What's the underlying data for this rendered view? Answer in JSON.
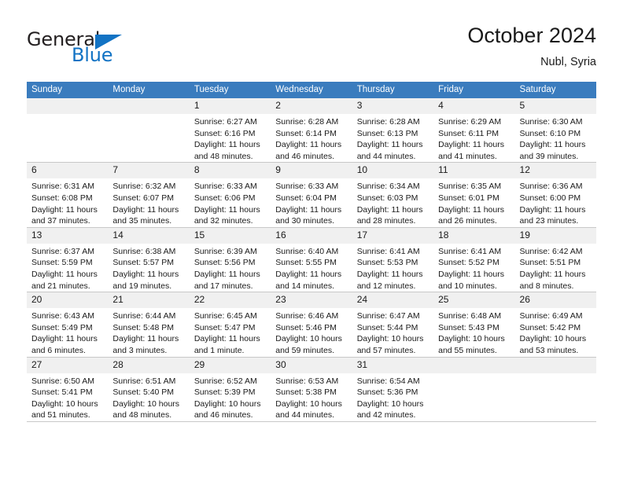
{
  "brand": {
    "name_part1": "General",
    "name_part2": "Blue",
    "accent_color": "#1273c4"
  },
  "header": {
    "title": "October 2024",
    "location": "Nubl, Syria"
  },
  "calendar": {
    "header_color": "#3a7cbe",
    "weekdays": [
      "Sunday",
      "Monday",
      "Tuesday",
      "Wednesday",
      "Thursday",
      "Friday",
      "Saturday"
    ],
    "weeks": [
      [
        {
          "day": ""
        },
        {
          "day": ""
        },
        {
          "day": "1",
          "sunrise": "Sunrise: 6:27 AM",
          "sunset": "Sunset: 6:16 PM",
          "daylight1": "Daylight: 11 hours",
          "daylight2": "and 48 minutes."
        },
        {
          "day": "2",
          "sunrise": "Sunrise: 6:28 AM",
          "sunset": "Sunset: 6:14 PM",
          "daylight1": "Daylight: 11 hours",
          "daylight2": "and 46 minutes."
        },
        {
          "day": "3",
          "sunrise": "Sunrise: 6:28 AM",
          "sunset": "Sunset: 6:13 PM",
          "daylight1": "Daylight: 11 hours",
          "daylight2": "and 44 minutes."
        },
        {
          "day": "4",
          "sunrise": "Sunrise: 6:29 AM",
          "sunset": "Sunset: 6:11 PM",
          "daylight1": "Daylight: 11 hours",
          "daylight2": "and 41 minutes."
        },
        {
          "day": "5",
          "sunrise": "Sunrise: 6:30 AM",
          "sunset": "Sunset: 6:10 PM",
          "daylight1": "Daylight: 11 hours",
          "daylight2": "and 39 minutes."
        }
      ],
      [
        {
          "day": "6",
          "sunrise": "Sunrise: 6:31 AM",
          "sunset": "Sunset: 6:08 PM",
          "daylight1": "Daylight: 11 hours",
          "daylight2": "and 37 minutes."
        },
        {
          "day": "7",
          "sunrise": "Sunrise: 6:32 AM",
          "sunset": "Sunset: 6:07 PM",
          "daylight1": "Daylight: 11 hours",
          "daylight2": "and 35 minutes."
        },
        {
          "day": "8",
          "sunrise": "Sunrise: 6:33 AM",
          "sunset": "Sunset: 6:06 PM",
          "daylight1": "Daylight: 11 hours",
          "daylight2": "and 32 minutes."
        },
        {
          "day": "9",
          "sunrise": "Sunrise: 6:33 AM",
          "sunset": "Sunset: 6:04 PM",
          "daylight1": "Daylight: 11 hours",
          "daylight2": "and 30 minutes."
        },
        {
          "day": "10",
          "sunrise": "Sunrise: 6:34 AM",
          "sunset": "Sunset: 6:03 PM",
          "daylight1": "Daylight: 11 hours",
          "daylight2": "and 28 minutes."
        },
        {
          "day": "11",
          "sunrise": "Sunrise: 6:35 AM",
          "sunset": "Sunset: 6:01 PM",
          "daylight1": "Daylight: 11 hours",
          "daylight2": "and 26 minutes."
        },
        {
          "day": "12",
          "sunrise": "Sunrise: 6:36 AM",
          "sunset": "Sunset: 6:00 PM",
          "daylight1": "Daylight: 11 hours",
          "daylight2": "and 23 minutes."
        }
      ],
      [
        {
          "day": "13",
          "sunrise": "Sunrise: 6:37 AM",
          "sunset": "Sunset: 5:59 PM",
          "daylight1": "Daylight: 11 hours",
          "daylight2": "and 21 minutes."
        },
        {
          "day": "14",
          "sunrise": "Sunrise: 6:38 AM",
          "sunset": "Sunset: 5:57 PM",
          "daylight1": "Daylight: 11 hours",
          "daylight2": "and 19 minutes."
        },
        {
          "day": "15",
          "sunrise": "Sunrise: 6:39 AM",
          "sunset": "Sunset: 5:56 PM",
          "daylight1": "Daylight: 11 hours",
          "daylight2": "and 17 minutes."
        },
        {
          "day": "16",
          "sunrise": "Sunrise: 6:40 AM",
          "sunset": "Sunset: 5:55 PM",
          "daylight1": "Daylight: 11 hours",
          "daylight2": "and 14 minutes."
        },
        {
          "day": "17",
          "sunrise": "Sunrise: 6:41 AM",
          "sunset": "Sunset: 5:53 PM",
          "daylight1": "Daylight: 11 hours",
          "daylight2": "and 12 minutes."
        },
        {
          "day": "18",
          "sunrise": "Sunrise: 6:41 AM",
          "sunset": "Sunset: 5:52 PM",
          "daylight1": "Daylight: 11 hours",
          "daylight2": "and 10 minutes."
        },
        {
          "day": "19",
          "sunrise": "Sunrise: 6:42 AM",
          "sunset": "Sunset: 5:51 PM",
          "daylight1": "Daylight: 11 hours",
          "daylight2": "and 8 minutes."
        }
      ],
      [
        {
          "day": "20",
          "sunrise": "Sunrise: 6:43 AM",
          "sunset": "Sunset: 5:49 PM",
          "daylight1": "Daylight: 11 hours",
          "daylight2": "and 6 minutes."
        },
        {
          "day": "21",
          "sunrise": "Sunrise: 6:44 AM",
          "sunset": "Sunset: 5:48 PM",
          "daylight1": "Daylight: 11 hours",
          "daylight2": "and 3 minutes."
        },
        {
          "day": "22",
          "sunrise": "Sunrise: 6:45 AM",
          "sunset": "Sunset: 5:47 PM",
          "daylight1": "Daylight: 11 hours",
          "daylight2": "and 1 minute."
        },
        {
          "day": "23",
          "sunrise": "Sunrise: 6:46 AM",
          "sunset": "Sunset: 5:46 PM",
          "daylight1": "Daylight: 10 hours",
          "daylight2": "and 59 minutes."
        },
        {
          "day": "24",
          "sunrise": "Sunrise: 6:47 AM",
          "sunset": "Sunset: 5:44 PM",
          "daylight1": "Daylight: 10 hours",
          "daylight2": "and 57 minutes."
        },
        {
          "day": "25",
          "sunrise": "Sunrise: 6:48 AM",
          "sunset": "Sunset: 5:43 PM",
          "daylight1": "Daylight: 10 hours",
          "daylight2": "and 55 minutes."
        },
        {
          "day": "26",
          "sunrise": "Sunrise: 6:49 AM",
          "sunset": "Sunset: 5:42 PM",
          "daylight1": "Daylight: 10 hours",
          "daylight2": "and 53 minutes."
        }
      ],
      [
        {
          "day": "27",
          "sunrise": "Sunrise: 6:50 AM",
          "sunset": "Sunset: 5:41 PM",
          "daylight1": "Daylight: 10 hours",
          "daylight2": "and 51 minutes."
        },
        {
          "day": "28",
          "sunrise": "Sunrise: 6:51 AM",
          "sunset": "Sunset: 5:40 PM",
          "daylight1": "Daylight: 10 hours",
          "daylight2": "and 48 minutes."
        },
        {
          "day": "29",
          "sunrise": "Sunrise: 6:52 AM",
          "sunset": "Sunset: 5:39 PM",
          "daylight1": "Daylight: 10 hours",
          "daylight2": "and 46 minutes."
        },
        {
          "day": "30",
          "sunrise": "Sunrise: 6:53 AM",
          "sunset": "Sunset: 5:38 PM",
          "daylight1": "Daylight: 10 hours",
          "daylight2": "and 44 minutes."
        },
        {
          "day": "31",
          "sunrise": "Sunrise: 6:54 AM",
          "sunset": "Sunset: 5:36 PM",
          "daylight1": "Daylight: 10 hours",
          "daylight2": "and 42 minutes."
        },
        {
          "day": ""
        },
        {
          "day": ""
        }
      ]
    ]
  }
}
